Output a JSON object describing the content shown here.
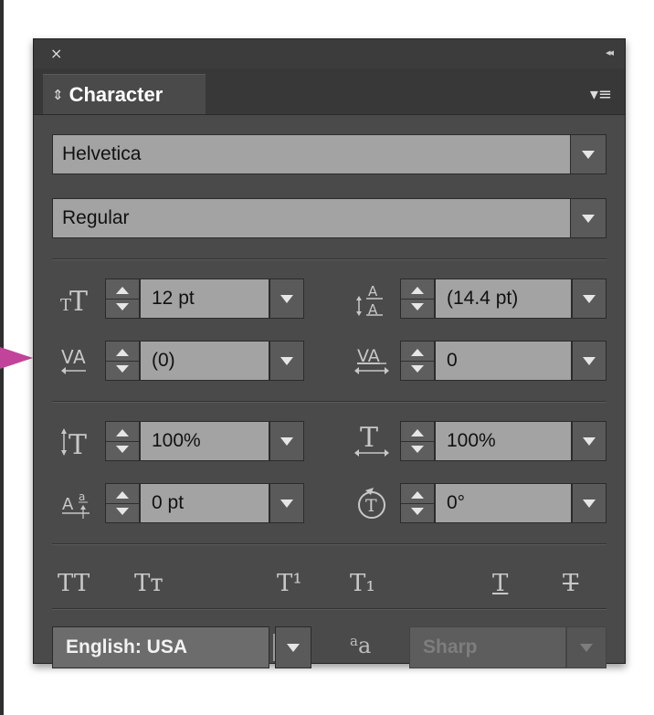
{
  "panel": {
    "tab_label": "Character",
    "close_glyph": "×",
    "collapse_glyph": "◂◂",
    "tab_arrows_glyph": "⇕",
    "menu_glyph": "▾≡"
  },
  "font": {
    "family": "Helvetica",
    "style": "Regular"
  },
  "fields": {
    "font_size": "12 pt",
    "leading": "(14.4 pt)",
    "kerning": "(0)",
    "tracking": "0",
    "vertical_scale": "100%",
    "horizontal_scale": "100%",
    "baseline_shift": "0 pt",
    "rotation": "0°"
  },
  "style_buttons": {
    "all_caps": "TT",
    "small_caps": "Tт",
    "superscript": "T¹",
    "subscript": "T₁",
    "underline": "T",
    "strikethrough": "T"
  },
  "bottom": {
    "language": "English: USA",
    "antialias_icon_big": "a",
    "antialias_icon_small": "a",
    "antialias": "Sharp"
  },
  "colors": {
    "panel_bg": "#4a4a4a",
    "field_bg": "#a3a3a3",
    "pointer_arrow": "#c2449a"
  }
}
